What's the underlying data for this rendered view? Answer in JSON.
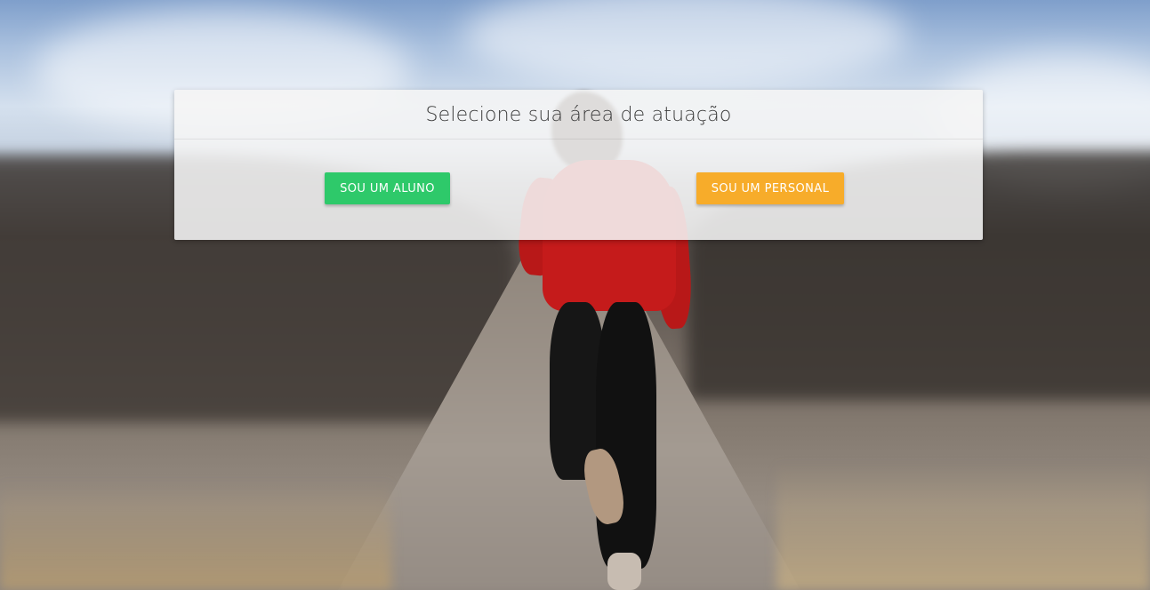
{
  "page": {
    "title": "Selecione sua área de atuação"
  },
  "actions": {
    "aluno_label": "SOU UM ALUNO",
    "personal_label": "SOU UM PERSONAL"
  },
  "colors": {
    "aluno_button": "#2ec96a",
    "personal_button": "#f7ac2a",
    "card_background": "#f5f5f5"
  }
}
